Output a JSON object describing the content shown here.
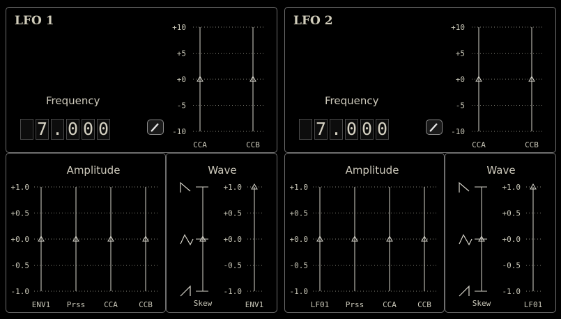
{
  "lfos": [
    {
      "title": "LFO 1",
      "frequency_label": "Frequency",
      "frequency_digits": [
        " ",
        "7",
        ".",
        "0",
        "0",
        "0"
      ],
      "edit_icon": "pencil-icon",
      "mod_scale": [
        "+10",
        "+5",
        "+0",
        "-5",
        "-10"
      ],
      "mod_sliders": [
        {
          "label": "CCA",
          "value": 0
        },
        {
          "label": "CCB",
          "value": 0
        }
      ],
      "amplitude_label": "Amplitude",
      "amp_scale": [
        "+1.0",
        "+0.5",
        "+0.0",
        "-0.5",
        "-1.0"
      ],
      "amp_sliders": [
        {
          "label": "ENV1",
          "value": 0
        },
        {
          "label": "Prss",
          "value": 0
        },
        {
          "label": "CCA",
          "value": 0
        },
        {
          "label": "CCB",
          "value": 0
        }
      ],
      "wave_label": "Wave",
      "skew_label": "Skew",
      "wave_scale": [
        "+1.0",
        "+0.5",
        "+0.0",
        "-0.5",
        "-1.0"
      ],
      "wave_slider": {
        "label": "ENV1",
        "value": 1.0
      }
    },
    {
      "title": "LFO 2",
      "frequency_label": "Frequency",
      "frequency_digits": [
        " ",
        "7",
        ".",
        "0",
        "0",
        "0"
      ],
      "edit_icon": "pencil-icon",
      "mod_scale": [
        "+10",
        "+5",
        "+0",
        "-5",
        "-10"
      ],
      "mod_sliders": [
        {
          "label": "CCA",
          "value": 0
        },
        {
          "label": "CCB",
          "value": 0
        }
      ],
      "amplitude_label": "Amplitude",
      "amp_scale": [
        "+1.0",
        "+0.5",
        "+0.0",
        "-0.5",
        "-1.0"
      ],
      "amp_sliders": [
        {
          "label": "LF01",
          "value": 0
        },
        {
          "label": "Prss",
          "value": 0
        },
        {
          "label": "CCA",
          "value": 0
        },
        {
          "label": "CCB",
          "value": 0
        }
      ],
      "wave_label": "Wave",
      "skew_label": "Skew",
      "wave_scale": [
        "+1.0",
        "+0.5",
        "+0.0",
        "-0.5",
        "-1.0"
      ],
      "wave_slider": {
        "label": "LF01",
        "value": 1.0
      }
    }
  ],
  "colors": {
    "grid": "#8a8a7e",
    "rail": "#d8d6cc",
    "text": "#c9c7b8",
    "border": "#6f6f6f"
  }
}
